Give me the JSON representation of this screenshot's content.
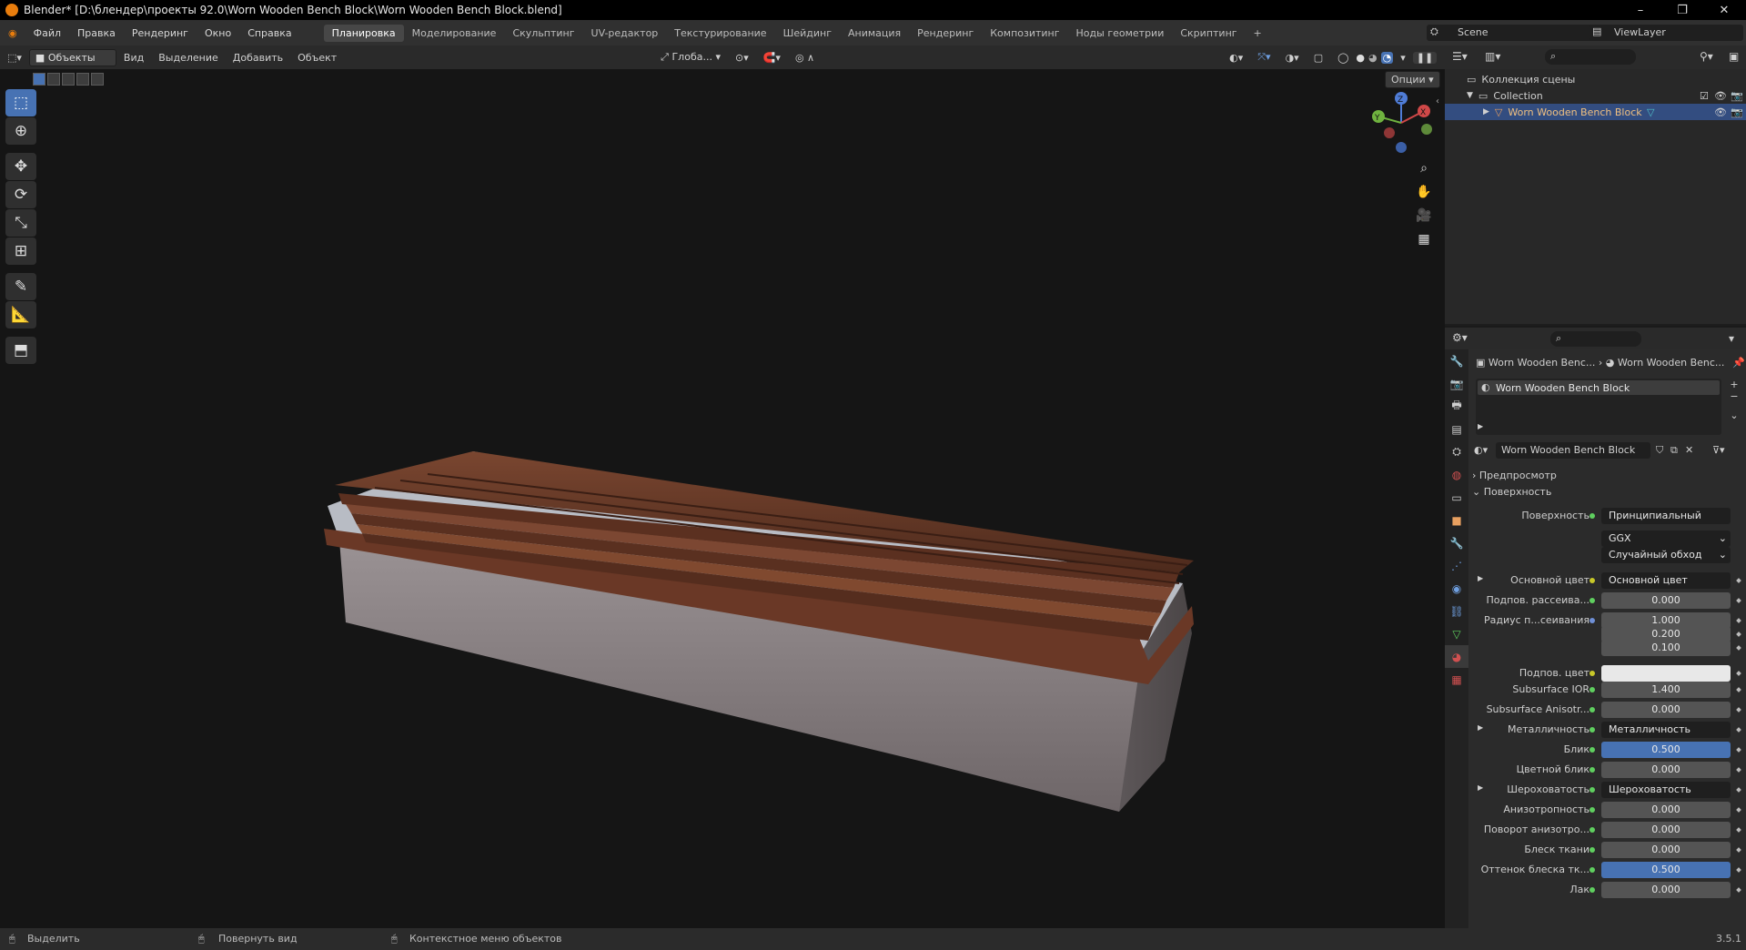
{
  "window": {
    "title": "Blender* [D:\\блендер\\проекты 92.0\\Worn Wooden Bench Block\\Worn Wooden Bench Block.blend]",
    "min": "–",
    "max": "❐",
    "close": "✕"
  },
  "menu": {
    "items": [
      "Файл",
      "Правка",
      "Рендеринг",
      "Окно",
      "Справка"
    ],
    "workspaces": [
      "Планировка",
      "Моделирование",
      "Скульптинг",
      "UV-редактор",
      "Текстурирование",
      "Шейдинг",
      "Анимация",
      "Рендеринг",
      "Композитинг",
      "Ноды геометрии",
      "Скриптинг"
    ],
    "active_workspace": "Планировка",
    "add_tab": "+",
    "scene": "Scene",
    "view_layer": "ViewLayer"
  },
  "viewport_header": {
    "mode": "Объекты",
    "menus": [
      "Вид",
      "Выделение",
      "Добавить",
      "Объект"
    ],
    "transform_orientation": "Глоба...",
    "options": "Опции"
  },
  "gizmo": {
    "x": "X",
    "y": "Y",
    "z": "Z"
  },
  "outliner": {
    "scene_collection": "Коллекция сцены",
    "collection": "Collection",
    "object": "Worn Wooden Bench Block"
  },
  "properties": {
    "breadcrumb_object": "Worn Wooden Benc...",
    "breadcrumb_material": "Worn Wooden Benc...",
    "material_slot": "Worn Wooden Bench Block",
    "material_name": "Worn Wooden Bench Block",
    "panel_preview": "Предпросмотр",
    "panel_surface": "Поверхность",
    "surface_label": "Поверхность",
    "surface_value": "Принципиальный BSDF",
    "distribution": "GGX",
    "subsurface_method": "Случайный обход",
    "rows": [
      {
        "label": "Основной цвет",
        "value": "Основной цвет",
        "type": "link",
        "dot": "y"
      },
      {
        "label": "Подпов. рассеива...",
        "value": "0.000",
        "type": "num",
        "dot": "g"
      },
      {
        "label": "Радиус п...сеивания",
        "value": "1.000",
        "type": "num",
        "dot": "b"
      },
      {
        "label": "",
        "value": "0.200",
        "type": "num",
        "dot": ""
      },
      {
        "label": "",
        "value": "0.100",
        "type": "num",
        "dot": ""
      },
      {
        "label": "Подпов. цвет",
        "value": "",
        "type": "color",
        "dot": "y"
      },
      {
        "label": "Subsurface IOR",
        "value": "1.400",
        "type": "num",
        "dot": "g"
      },
      {
        "label": "Subsurface Anisotr...",
        "value": "0.000",
        "type": "num",
        "dot": "g"
      },
      {
        "label": "Металличность",
        "value": "Металличность",
        "type": "link",
        "dot": "g"
      },
      {
        "label": "Блик",
        "value": "0.500",
        "type": "sel",
        "dot": "g"
      },
      {
        "label": "Цветной блик",
        "value": "0.000",
        "type": "num",
        "dot": "g"
      },
      {
        "label": "Шероховатость",
        "value": "Шероховатость",
        "type": "link",
        "dot": "g"
      },
      {
        "label": "Анизотропность",
        "value": "0.000",
        "type": "num",
        "dot": "g"
      },
      {
        "label": "Поворот анизотро...",
        "value": "0.000",
        "type": "num",
        "dot": "g"
      },
      {
        "label": "Блеск ткани",
        "value": "0.000",
        "type": "num",
        "dot": "g"
      },
      {
        "label": "Оттенок блеска тк...",
        "value": "0.500",
        "type": "sel",
        "dot": "g"
      },
      {
        "label": "Лак",
        "value": "0.000",
        "type": "num",
        "dot": "g"
      }
    ]
  },
  "status": {
    "select": "Выделить",
    "rotate_view": "Повернуть вид",
    "context_menu": "Контекстное меню объектов",
    "version": "3.5.1"
  }
}
